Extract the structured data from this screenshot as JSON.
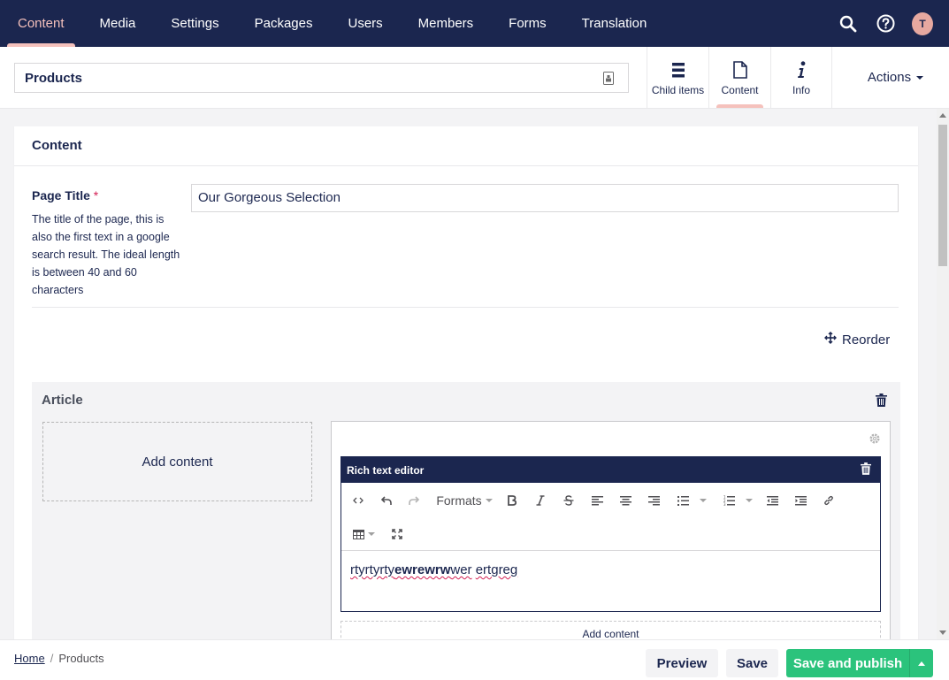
{
  "nav": {
    "sections": [
      "Content",
      "Media",
      "Settings",
      "Packages",
      "Users",
      "Members",
      "Forms",
      "Translation"
    ],
    "active_section": "Content",
    "avatar_initial": "T",
    "accent_color": "#f5c1bc",
    "bar_color": "#1b264f"
  },
  "editor": {
    "node_name": "Products",
    "apps": [
      {
        "label": "Child items",
        "icon": "list-icon"
      },
      {
        "label": "Content",
        "icon": "document-icon"
      },
      {
        "label": "Info",
        "icon": "info-icon"
      }
    ],
    "actions_label": "Actions"
  },
  "content": {
    "group_title": "Content",
    "page_title_label": "Page Title",
    "required_marker": "*",
    "page_title_description": "The title of the page, this is also the first text in a google search result. The ideal length is between 40 and 60 characters",
    "page_title_value": "Our Gorgeous Selection",
    "reorder_label": "Reorder",
    "article": {
      "title": "Article",
      "add_content_label": "Add content",
      "rte_title": "Rich text editor",
      "formats_label": "Formats",
      "body_parts": [
        "rtyrtyrty",
        "ewrewrw",
        "wer",
        "ertgreg"
      ],
      "add_content_bottom_label": "Add content"
    }
  },
  "footer": {
    "breadcrumb_home": "Home",
    "breadcrumb_separator": "/",
    "breadcrumb_current": "Products",
    "preview_label": "Preview",
    "save_label": "Save",
    "publish_label": "Save and publish",
    "publish_color": "#2bc37c"
  }
}
